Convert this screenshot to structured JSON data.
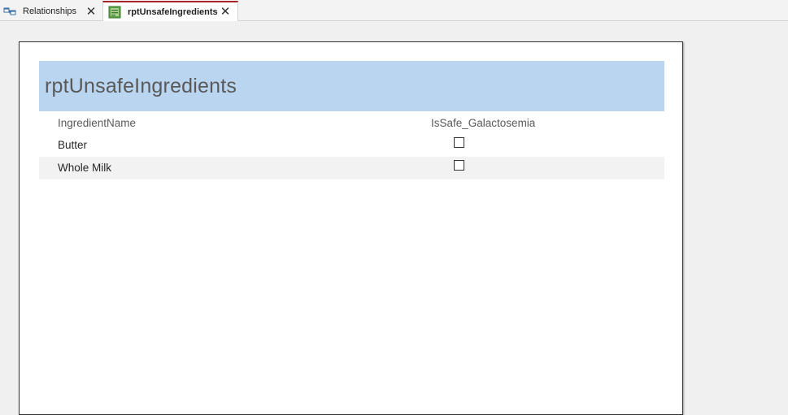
{
  "tabs": [
    {
      "label": "Relationships",
      "icon": "relationships-icon",
      "active": false,
      "close": "✕"
    },
    {
      "label": "rptUnsafeIngredients",
      "icon": "report-icon",
      "active": true,
      "close": "✕"
    }
  ],
  "report": {
    "title": "rptUnsafeIngredients",
    "columns": [
      "IngredientName",
      "IsSafe_Galactosemia"
    ],
    "rows": [
      {
        "IngredientName": "Butter",
        "IsSafe_Galactosemia": false
      },
      {
        "IngredientName": "Whole Milk",
        "IsSafe_Galactosemia": false
      }
    ]
  },
  "colors": {
    "header_band": "#bad5f0",
    "active_tab_accent": "#a4262c",
    "alt_row": "#f2f2f2"
  }
}
